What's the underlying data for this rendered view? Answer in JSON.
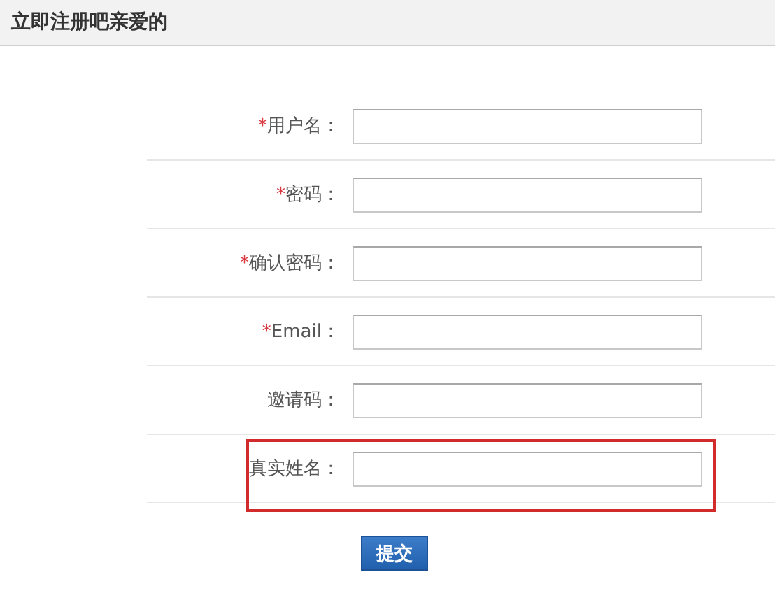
{
  "header": {
    "title": "立即注册吧亲爱的"
  },
  "fields": [
    {
      "marker": "*",
      "label": "用户名：",
      "highlighted": false
    },
    {
      "marker": "*",
      "label": "密码：",
      "highlighted": false
    },
    {
      "marker": "*",
      "label": "确认密码：",
      "highlighted": false
    },
    {
      "marker": "*",
      "label": "Email：",
      "highlighted": false
    },
    {
      "label": "邀请码：",
      "highlighted": false
    },
    {
      "label": "真实姓名：",
      "highlighted": true
    }
  ],
  "submit_button": "提交"
}
